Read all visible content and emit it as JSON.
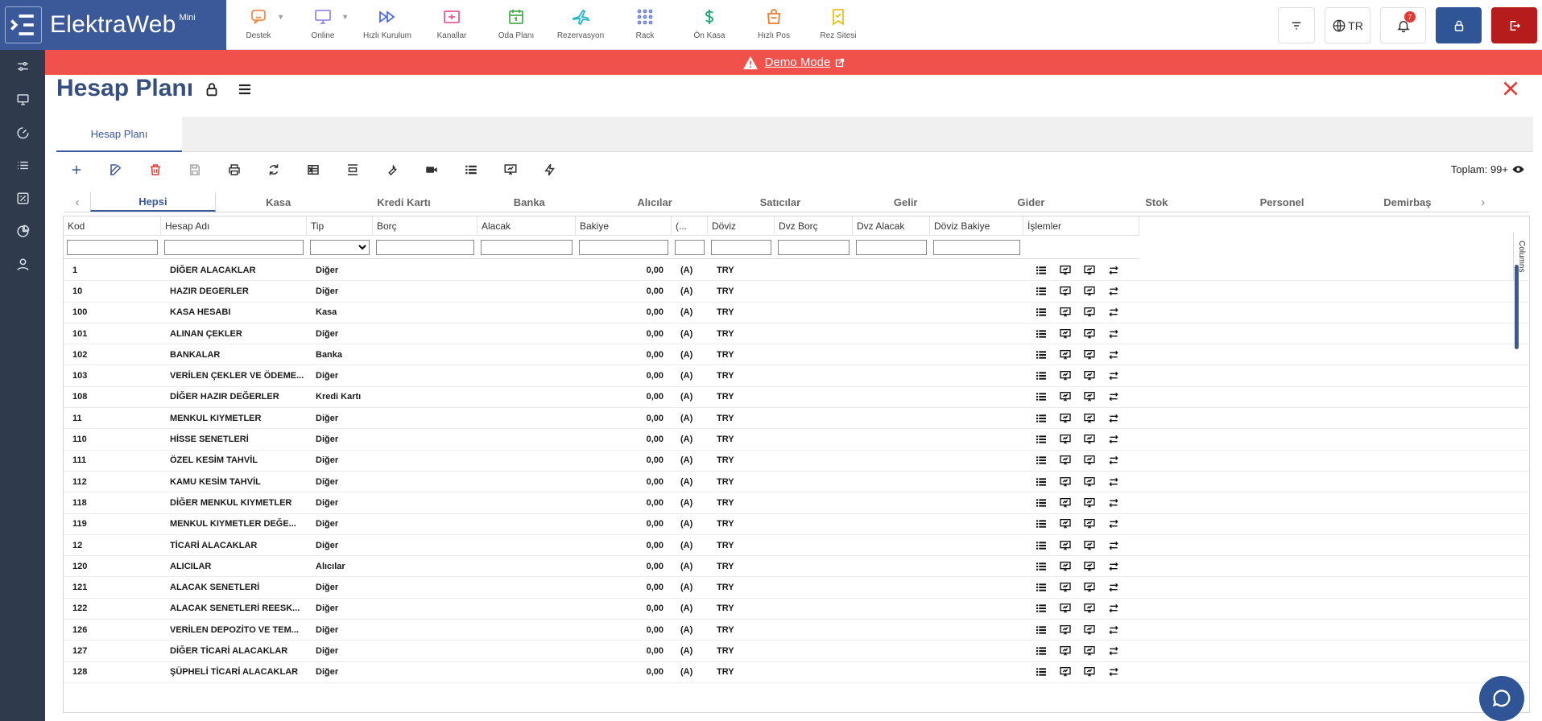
{
  "brand": {
    "name": "ElektraWeb",
    "edition": "Mini"
  },
  "quick_nav": [
    {
      "label": "Destek",
      "icon": "chat-icon",
      "color": "#f08a4b",
      "caret": true
    },
    {
      "label": "Online",
      "icon": "monitor-icon",
      "color": "#9b8ae6",
      "caret": true
    },
    {
      "label": "Hızlı Kurulum",
      "icon": "fast-forward-icon",
      "color": "#4f6fe0"
    },
    {
      "label": "Kanallar",
      "icon": "channel-icon",
      "color": "#e25c9c"
    },
    {
      "label": "Oda Planı",
      "icon": "calendar-icon",
      "color": "#4caf50"
    },
    {
      "label": "Rezervasyon",
      "icon": "plane-icon",
      "color": "#1fb6c9"
    },
    {
      "label": "Rack",
      "icon": "grid-dots-icon",
      "color": "#6c7fd6"
    },
    {
      "label": "Ön Kasa",
      "icon": "dollar-icon",
      "color": "#1ba672"
    },
    {
      "label": "Hızlı Pos",
      "icon": "bag-icon",
      "color": "#ef7b2d"
    },
    {
      "label": "Rez Sitesi",
      "icon": "bookmark-icon",
      "color": "#e8c118"
    }
  ],
  "topbar": {
    "language": "TR",
    "notifications": "7"
  },
  "demo_banner": {
    "label": "Demo Mode"
  },
  "page": {
    "title": "Hesap Planı",
    "tab": "Hesap Planı",
    "total": "Toplam: 99+"
  },
  "category_tabs": [
    "Hepsi",
    "Kasa",
    "Kredi Kartı",
    "Banka",
    "Alıcılar",
    "Satıcılar",
    "Gelir",
    "Gider",
    "Stok",
    "Personel",
    "Demirbaş"
  ],
  "grid": {
    "columns": [
      "Kod",
      "Hesap Adı",
      "Tip",
      "Borç",
      "Alacak",
      "Bakiye",
      "(...",
      "Döviz",
      "Dvz Borç",
      "Dvz Alacak",
      "Döviz Bakiye",
      "İşlemler"
    ],
    "columns_panel": "Columns",
    "rows": [
      {
        "kod": "1",
        "ad": "DİĞER ALACAKLAR",
        "tip": "Diğer",
        "bakiye": "0,00",
        "ba": "(A)",
        "doviz": "TRY"
      },
      {
        "kod": "10",
        "ad": "HAZIR DEGERLER",
        "tip": "Diğer",
        "bakiye": "0,00",
        "ba": "(A)",
        "doviz": "TRY"
      },
      {
        "kod": "100",
        "ad": "KASA HESABI",
        "tip": "Kasa",
        "bakiye": "0,00",
        "ba": "(A)",
        "doviz": "TRY"
      },
      {
        "kod": "101",
        "ad": "ALINAN ÇEKLER",
        "tip": "Diğer",
        "bakiye": "0,00",
        "ba": "(A)",
        "doviz": "TRY"
      },
      {
        "kod": "102",
        "ad": "BANKALAR",
        "tip": "Banka",
        "bakiye": "0,00",
        "ba": "(A)",
        "doviz": "TRY"
      },
      {
        "kod": "103",
        "ad": "VERİLEN ÇEKLER VE ÖDEME...",
        "tip": "Diğer",
        "bakiye": "0,00",
        "ba": "(A)",
        "doviz": "TRY"
      },
      {
        "kod": "108",
        "ad": "DİĞER HAZIR DEĞERLER",
        "tip": "Kredi Kartı",
        "bakiye": "0,00",
        "ba": "(A)",
        "doviz": "TRY"
      },
      {
        "kod": "11",
        "ad": "MENKUL KIYMETLER",
        "tip": "Diğer",
        "bakiye": "0,00",
        "ba": "(A)",
        "doviz": "TRY"
      },
      {
        "kod": "110",
        "ad": "HİSSE SENETLERİ",
        "tip": "Diğer",
        "bakiye": "0,00",
        "ba": "(A)",
        "doviz": "TRY"
      },
      {
        "kod": "111",
        "ad": "ÖZEL KESİM TAHVİL",
        "tip": "Diğer",
        "bakiye": "0,00",
        "ba": "(A)",
        "doviz": "TRY"
      },
      {
        "kod": "112",
        "ad": "KAMU KESİM TAHVİL",
        "tip": "Diğer",
        "bakiye": "0,00",
        "ba": "(A)",
        "doviz": "TRY"
      },
      {
        "kod": "118",
        "ad": "DİĞER MENKUL KIYMETLER",
        "tip": "Diğer",
        "bakiye": "0,00",
        "ba": "(A)",
        "doviz": "TRY"
      },
      {
        "kod": "119",
        "ad": "MENKUL KIYMETLER DEĞE...",
        "tip": "Diğer",
        "bakiye": "0,00",
        "ba": "(A)",
        "doviz": "TRY"
      },
      {
        "kod": "12",
        "ad": "TİCARİ ALACAKLAR",
        "tip": "Diğer",
        "bakiye": "0,00",
        "ba": "(A)",
        "doviz": "TRY"
      },
      {
        "kod": "120",
        "ad": "ALICILAR",
        "tip": "Alıcılar",
        "bakiye": "0,00",
        "ba": "(A)",
        "doviz": "TRY"
      },
      {
        "kod": "121",
        "ad": "ALACAK SENETLERİ",
        "tip": "Diğer",
        "bakiye": "0,00",
        "ba": "(A)",
        "doviz": "TRY"
      },
      {
        "kod": "122",
        "ad": "ALACAK SENETLERİ REESK...",
        "tip": "Diğer",
        "bakiye": "0,00",
        "ba": "(A)",
        "doviz": "TRY"
      },
      {
        "kod": "126",
        "ad": "VERİLEN DEPOZİTO VE TEM...",
        "tip": "Diğer",
        "bakiye": "0,00",
        "ba": "(A)",
        "doviz": "TRY"
      },
      {
        "kod": "127",
        "ad": "DİĞER TİCARİ ALACAKLAR",
        "tip": "Diğer",
        "bakiye": "0,00",
        "ba": "(A)",
        "doviz": "TRY"
      },
      {
        "kod": "128",
        "ad": "ŞÜPHELİ TİCARİ ALACAKLAR",
        "tip": "Diğer",
        "bakiye": "0,00",
        "ba": "(A)",
        "doviz": "TRY"
      }
    ]
  },
  "colors": {
    "brand": "#3b5998",
    "rail": "#2f3a4d",
    "demo": "#f0524b",
    "danger": "#b71c1c"
  }
}
